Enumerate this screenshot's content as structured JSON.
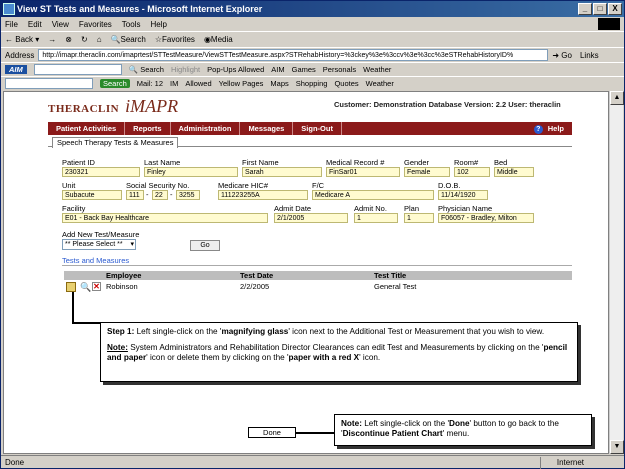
{
  "window": {
    "title": "View ST Tests and Measures - Microsoft Internet Explorer",
    "minimize": "_",
    "maximize": "□",
    "close": "X"
  },
  "menubar": [
    "File",
    "Edit",
    "View",
    "Favorites",
    "Tools",
    "Help"
  ],
  "toolbar": {
    "back": "Back",
    "forward": "→",
    "stop": "⊗",
    "refresh": "↻",
    "home": "⌂",
    "search": "Search",
    "favorites": "Favorites",
    "media": "Media"
  },
  "address": {
    "label": "Address",
    "url": "http://imapr.theraclin.com/imaprtest/STTestMeasure/ViewSTTestMeasure.aspx?STRehabHistory=%3ckey%3e%3ccv%3e%3cc%3eSTRehabHistoryID%",
    "go": "Go",
    "links": "Links"
  },
  "aimbar": {
    "logo": "AIM",
    "search": "Search",
    "highlight": "Highlight",
    "popups": "Pop-Ups Allowed",
    "aim": "AIM",
    "games": "Games",
    "personals": "Personals",
    "weather": "Weather"
  },
  "yahoobar": {
    "search": "Search",
    "mail": "Mail: 12",
    "im": "IM",
    "allowed": "Allowed",
    "yellow": "Yellow Pages",
    "maps": "Maps",
    "shopping": "Shopping",
    "quotes": "Quotes",
    "weather": "Weather"
  },
  "app": {
    "brand1": "THERACLIN",
    "brand2": "iMAPR",
    "customer": "Customer: Demonstration Database  Version: 2.2  User: theraclin",
    "nav": [
      "Patient Activities",
      "Reports",
      "Administration",
      "Messages",
      "Sign-Out"
    ],
    "help": "Help",
    "tab": "Speech Therapy Tests & Measures"
  },
  "patient": {
    "labels": {
      "id": "Patient ID",
      "last": "Last Name",
      "first": "First Name",
      "mr": "Medical Record #",
      "gender": "Gender",
      "room": "Room#",
      "bed": "Bed",
      "unit": "Unit",
      "ssn": "Social Security No.",
      "medicare": "Medicare HIC#",
      "fc": "F/C",
      "dob": "D.O.B.",
      "facility": "Facility",
      "admit_date": "Admit Date",
      "admit_no": "Admit No.",
      "plan": "Plan",
      "physician": "Physician Name"
    },
    "id": "230321",
    "last": "Finley",
    "first": "Sarah",
    "mr": "FinSar01",
    "gender": "Female",
    "room": "102",
    "bed": "Middle",
    "unit": "Subacute",
    "ssn1": "111",
    "ssn2": "22",
    "ssn3": "3255",
    "medicare": "111223255A",
    "fc": "Medicare A",
    "dob": "11/14/1920",
    "facility": "E01 - Back Bay Healthcare",
    "admit_date": "2/1/2005",
    "admit_no": "1",
    "plan": "1",
    "physician": "F06057 - Bradley, Milton"
  },
  "add_new": {
    "label": "Add New Test/Measure",
    "select": "** Please Select **",
    "go": "Go"
  },
  "tests": {
    "title": "Tests and Measures",
    "headers": [
      "Employee",
      "Test Date",
      "Test Title"
    ],
    "rows": [
      {
        "employee": "Robinson",
        "date": "2/2/2005",
        "title": "General Test"
      }
    ]
  },
  "callout1": {
    "step_prefix": "Step 1:",
    "line1a": " Left single-click on the '",
    "line1b": "magnifying glass",
    "line1c": "' icon next to the Additional Test or Measurement that you wish to view.",
    "note_prefix": "Note:",
    "note_a": " System Administrators and Rehabilitation Director Clearances can edit Test and Measurements by clicking on the '",
    "note_b": "pencil and paper",
    "note_c": "' icon or delete them by clicking on the '",
    "note_d": "paper with a red X",
    "note_e": "' icon."
  },
  "callout2": {
    "note_prefix": "Note:",
    "text_a": " Left single-click on the '",
    "text_b": "Done",
    "text_c": "' button to go back to the '",
    "text_d": "Discontinue Patient Chart",
    "text_e": "' menu."
  },
  "done": "Done",
  "status": {
    "left": "Done",
    "zone": "Internet"
  }
}
